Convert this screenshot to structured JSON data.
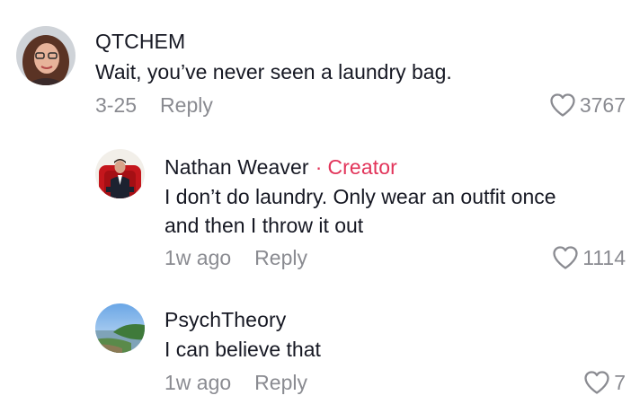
{
  "comments": [
    {
      "username": "QTCHEM",
      "text_lines": [
        "Wait, you’ve never seen a laundry bag."
      ],
      "date": "3-25",
      "reply_label": "Reply",
      "like_count": "3767",
      "avatar_icon": "user-avatar-woman-icon"
    },
    {
      "username": "Nathan Weaver",
      "separator": "·",
      "badge": "Creator",
      "text_lines": [
        "I don’t do laundry. Only wear an outfit once",
        "and then I throw it out"
      ],
      "date": "1w ago",
      "reply_label": "Reply",
      "like_count": "1114",
      "avatar_icon": "user-avatar-man-icon"
    },
    {
      "username": "PsychTheory",
      "text_lines": [
        "I can believe that"
      ],
      "date": "1w ago",
      "reply_label": "Reply",
      "like_count": "7",
      "avatar_icon": "user-avatar-landscape-icon"
    }
  ],
  "colors": {
    "text": "#161823",
    "muted": "#8a8b91",
    "creator_accent": "#e2345a"
  }
}
